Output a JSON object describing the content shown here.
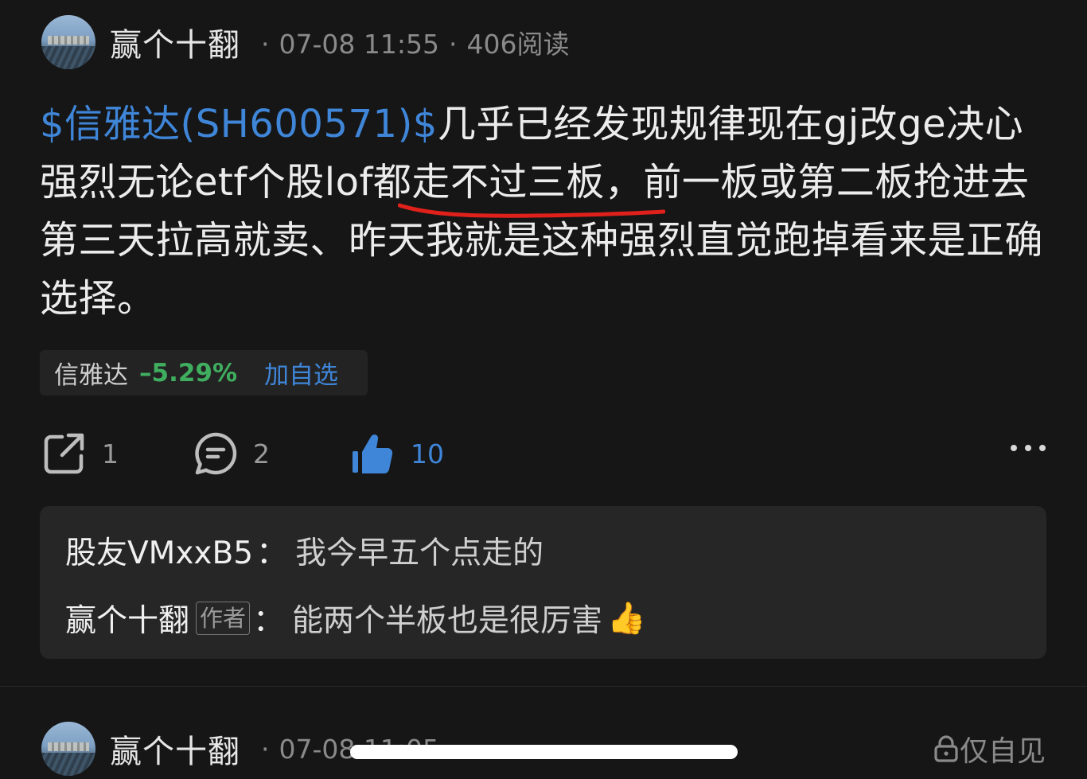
{
  "post1": {
    "author": "赢个十翻",
    "date": "07-08 11:55",
    "reads": "406阅读",
    "stock_link": "$信雅达(SH600571)$",
    "body_text": "几乎已经发现规律现在gj改ge决心强烈无论etf个股lof都走不过三板，前一板或第二板抢进去第三天拉高就卖、昨天我就是这种强烈直觉跑掉看来是正确选择。"
  },
  "stock_chip": {
    "name": "信雅达",
    "change": "–5.29%",
    "add_label": "加自选"
  },
  "actions": {
    "share_count": "1",
    "comment_count": "2",
    "like_count": "10",
    "share_icon": "share-icon",
    "comment_icon": "comment-icon",
    "like_icon": "thumbs-up-icon",
    "more_icon": "more-icon"
  },
  "comments": [
    {
      "user": "股友VMxxB5",
      "separator": "：",
      "text": "我今早五个点走的"
    },
    {
      "user": "赢个十翻",
      "tag": "作者",
      "separator": "：",
      "text": "能两个半板也是很厉害",
      "emoji": "👍"
    }
  ],
  "post2": {
    "author": "赢个十翻",
    "date": "07-08 11:05",
    "privacy_label": "仅自见",
    "privacy_icon": "lock-icon"
  },
  "colors": {
    "background": "#161616",
    "link_blue": "#3f86d9",
    "down_green": "#3fae5f",
    "underline_red": "#e0211b"
  }
}
